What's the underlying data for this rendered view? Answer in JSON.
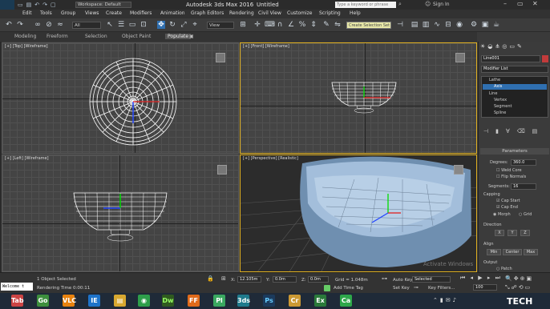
{
  "title": {
    "workspace_label": "Workspace: Default",
    "app_title": "Autodesk 3ds Max 2016",
    "doc_title": "Untitled",
    "search_placeholder": "Type a keyword or phrase",
    "sign_in": "Sign In",
    "logo": "MAX"
  },
  "menu": [
    "Edit",
    "Tools",
    "Group",
    "Views",
    "Create",
    "Modifiers",
    "Animation",
    "Graph Editors",
    "Rendering",
    "Civil View",
    "Customize",
    "Scripting",
    "Help"
  ],
  "toolbar": {
    "filter_value": "All",
    "view_value": "View",
    "selection_set_placeholder": "Create Selection Set"
  },
  "ribbon_tabs": [
    "Modeling",
    "Freeform",
    "Selection",
    "Object Paint",
    "Populate"
  ],
  "viewports": {
    "top": "[+] [Top] [Wireframe]",
    "front": "[+] [Front] [Wireframe]",
    "left": "[+] [Left] [Wireframe]",
    "perspective": "[+] [Perspective] [Realistic]"
  },
  "panel": {
    "object_name": "Line001",
    "modifier_list": "Modifier List",
    "stack": [
      "Lathe",
      "Axis",
      "Line",
      "Vertex",
      "Segment",
      "Spline"
    ],
    "rollout_title": "Parameters",
    "degrees_label": "Degrees:",
    "degrees_value": "360.0",
    "weld_core": "Weld Core",
    "flip_normals": "Flip Normals",
    "segments_label": "Segments:",
    "segments_value": "16",
    "capping_label": "Capping",
    "cap_start": "Cap Start",
    "cap_end": "Cap End",
    "morph": "Morph",
    "grid": "Grid",
    "direction_label": "Direction",
    "dir_x": "X",
    "dir_y": "Y",
    "dir_z": "Z",
    "align_label": "Align",
    "align_min": "Min",
    "align_center": "Center",
    "align_max": "Max",
    "output_label": "Output",
    "output_patch": "Patch"
  },
  "status": {
    "welcome": "Welcome t",
    "selected": "1 Object Selected",
    "render_time": "Rendering Time 0:00:11",
    "x_label": "X:",
    "x_value": "12.105m",
    "y_label": "Y:",
    "y_value": "0.0m",
    "z_label": "Z:",
    "z_value": "0.0m",
    "grid": "Grid = 1.048m",
    "add_time_tag": "Add Time Tag",
    "auto_key": "Auto Key",
    "auto_key_value": "Selected",
    "set_key": "Set Key",
    "key_filters": "Key Filters...",
    "frame_value": "100"
  },
  "watermark": "Activate Windows",
  "brand": "TECH",
  "taskbar_icons": [
    "Tab",
    "Go",
    "VLC",
    "IE",
    "Dw",
    "FF",
    "Pl",
    "3ds",
    "Ps",
    "Cr",
    "Ex",
    "Ca"
  ]
}
